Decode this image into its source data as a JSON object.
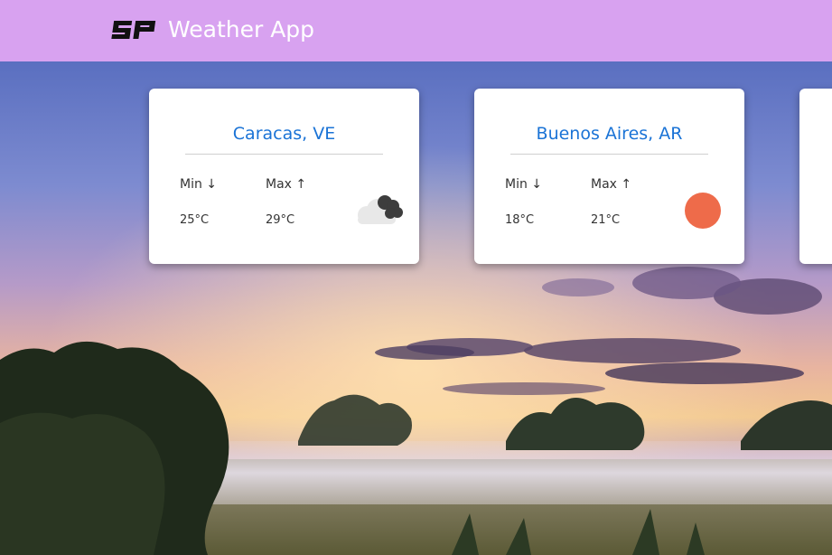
{
  "header": {
    "logo_text": "SP",
    "title": "Weather App",
    "bg_color": "#d8a2f0"
  },
  "accent_color": "#1a73d6",
  "cards": [
    {
      "city": "Caracas, VE",
      "min_label": "Min",
      "min_arrow": "↓",
      "min_value": "25°C",
      "max_label": "Max",
      "max_arrow": "↑",
      "max_value": "29°C",
      "icon": "cloudy-icon"
    },
    {
      "city": "Buenos Aires, AR",
      "min_label": "Min",
      "min_arrow": "↓",
      "min_value": "18°C",
      "max_label": "Max",
      "max_arrow": "↑",
      "max_value": "21°C",
      "icon": "sun-icon",
      "icon_color": "#ee6b4a"
    }
  ]
}
